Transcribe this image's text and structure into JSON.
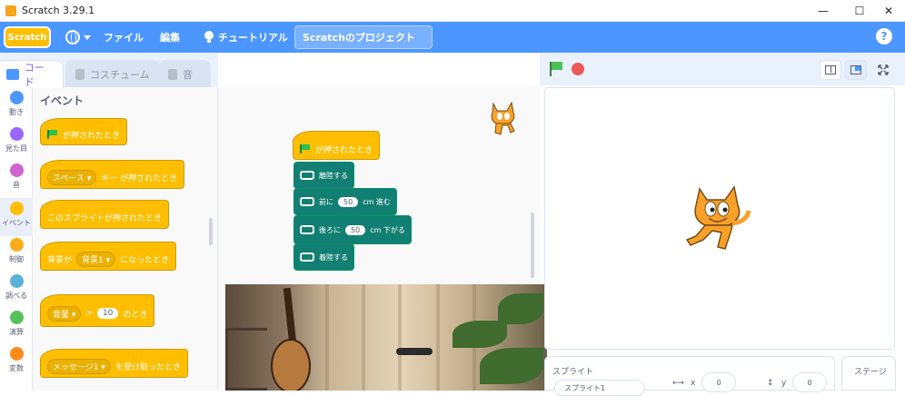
{
  "window": {
    "title": "Scratch 3.29.1",
    "minimize": "—",
    "maximize": "☐",
    "close": "✕"
  },
  "menubar": {
    "logo": "Scratch",
    "language_icon": "globe-icon",
    "file": "ファイル",
    "edit": "編集",
    "tutorials": "チュートリアル",
    "project_title": "Scratchのプロジェクト",
    "help": "?"
  },
  "tabs": [
    {
      "label": "コード",
      "active": true
    },
    {
      "label": "コスチューム",
      "active": false
    },
    {
      "label": "音",
      "active": false
    }
  ],
  "categories": [
    {
      "label": "動き",
      "color": "#4c97ff"
    },
    {
      "label": "見た目",
      "color": "#9966ff"
    },
    {
      "label": "音",
      "color": "#cf63cf"
    },
    {
      "label": "イベント",
      "color": "#ffbf00"
    },
    {
      "label": "制御",
      "color": "#ffab19"
    },
    {
      "label": "調べる",
      "color": "#5cb1d6"
    },
    {
      "label": "演算",
      "color": "#59c059"
    },
    {
      "label": "変数",
      "color": "#ff8c1a"
    }
  ],
  "palette": {
    "heading": "イベント",
    "blocks": {
      "flag_clicked": "が押されたとき",
      "key_pressed_key": "スペース",
      "key_pressed_suffix": "キー が押されたとき",
      "sprite_clicked": "このスプライトが押されたとき",
      "backdrop_prefix": "背景が",
      "backdrop_value": "背景1",
      "backdrop_suffix": "になったとき",
      "loudness_dd": "音量",
      "loudness_gt": ">",
      "loudness_value": "10",
      "loudness_suffix": "のとき",
      "receive_value": "メッセージ1",
      "receive_suffix": "を受け取ったとき"
    }
  },
  "script": {
    "hat": "が押されたとき",
    "takeoff": "離陸する",
    "forward_prefix": "前に",
    "forward_value": "50",
    "forward_suffix": "cm 進む",
    "back_prefix": "後ろに",
    "back_value": "50",
    "back_suffix": "cm 下がる",
    "land": "着陸する"
  },
  "sprite_info": {
    "label": "スプライト",
    "name_partial": "スプライト1",
    "x_label": "x",
    "x_value": "0",
    "y_label": "y",
    "y_value": "0"
  },
  "stage_pane": {
    "label": "ステージ"
  },
  "colors": {
    "menubar": "#4c97ff",
    "events": "#ffbf00",
    "extension": "#117f72",
    "accent": "#855cd6"
  }
}
